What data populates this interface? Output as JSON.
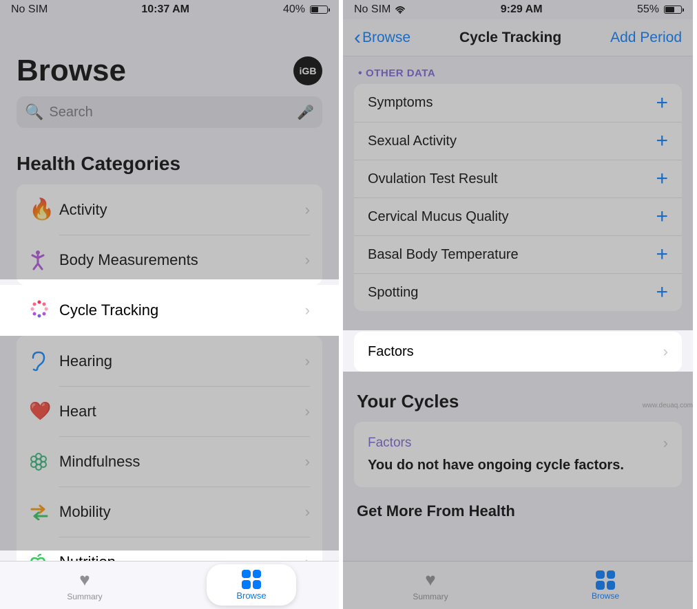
{
  "left": {
    "status": {
      "carrier": "No SIM",
      "time": "10:37 AM",
      "battery_pct": "40%",
      "battery_fill": 40
    },
    "title": "Browse",
    "avatar": "iGB",
    "search_placeholder": "Search",
    "section_title": "Health Categories",
    "categories": [
      {
        "id": "activity",
        "label": "Activity",
        "color": "#ff3b30"
      },
      {
        "id": "body",
        "label": "Body Measurements",
        "color": "#af52de"
      },
      {
        "id": "cycle",
        "label": "Cycle Tracking",
        "color": "#ff2d55",
        "highlight": true
      },
      {
        "id": "hearing",
        "label": "Hearing",
        "color": "#0a84ff"
      },
      {
        "id": "heart",
        "label": "Heart",
        "color": "#ff3b30"
      },
      {
        "id": "mindfulness",
        "label": "Mindfulness",
        "color": "#30d158"
      },
      {
        "id": "mobility",
        "label": "Mobility",
        "color": "#ff9500"
      },
      {
        "id": "nutrition",
        "label": "Nutrition",
        "color": "#34c759"
      }
    ],
    "tabs": {
      "summary": "Summary",
      "browse": "Browse"
    }
  },
  "right": {
    "status": {
      "carrier": "No SIM",
      "time": "9:29 AM",
      "battery_pct": "55%",
      "battery_fill": 55
    },
    "nav": {
      "back": "Browse",
      "title": "Cycle Tracking",
      "action": "Add Period"
    },
    "section_header": "OTHER DATA",
    "data_items": [
      {
        "label": "Symptoms"
      },
      {
        "label": "Sexual Activity"
      },
      {
        "label": "Ovulation Test Result"
      },
      {
        "label": "Cervical Mucus Quality"
      },
      {
        "label": "Basal Body Temperature"
      },
      {
        "label": "Spotting"
      }
    ],
    "factors_row": "Factors",
    "your_cycles_title": "Your Cycles",
    "factors_card": {
      "title": "Factors",
      "body": "You do not have ongoing cycle factors."
    },
    "more_title": "Get More From Health",
    "tabs": {
      "summary": "Summary",
      "browse": "Browse"
    }
  },
  "watermark": "www.deuaq.com"
}
